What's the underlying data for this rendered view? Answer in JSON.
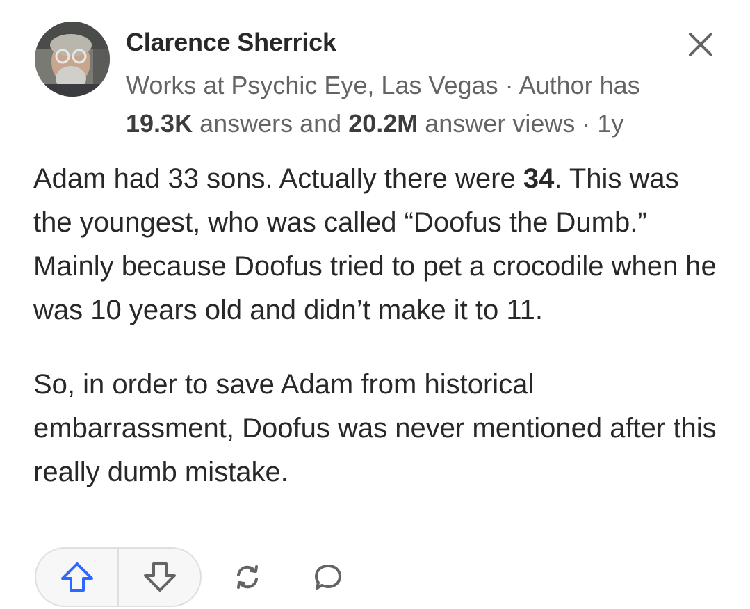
{
  "author": {
    "name": "Clarence Sherrick",
    "credential": "Works at Psychic Eye, Las Vegas",
    "sep1": " · ",
    "stats_prefix": "Author has ",
    "answers_count": "19.3K",
    "answers_label": " answers and ",
    "views_count": "20.2M",
    "views_label": " answer views",
    "sep2": " · ",
    "age": "1y"
  },
  "answer": {
    "p1_part1": "Adam had 33 sons. Actually there were ",
    "p1_bold": "34",
    "p1_part2": ". This was the youngest, who was called “Doofus the Dumb.” Mainly because Doofus tried to pet a crocodile when he was 10 years old and didn’t make it to 11.",
    "p2": "So, in order to save Adam from historical embarrassment, Doofus was never mentioned after this really dumb mistake."
  },
  "icons": {
    "close": "close-icon",
    "upvote": "upvote-arrow-icon",
    "downvote": "downvote-arrow-icon",
    "share": "share-refresh-icon",
    "comment": "comment-bubble-icon"
  },
  "colors": {
    "upvote_accent": "#2e69ff",
    "text_primary": "#282829",
    "text_secondary": "#636466"
  }
}
